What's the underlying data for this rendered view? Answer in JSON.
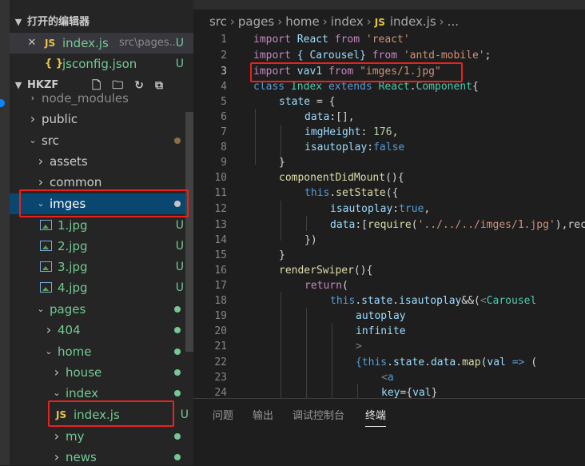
{
  "colors": {
    "accent": "#094771",
    "highlight_box": "#e8221d",
    "git_untracked": "#73c991",
    "git_modified": "#8c6d46"
  },
  "sidebar": {
    "open_editors_title": "打开的编辑器",
    "open_editors": [
      {
        "name": "index.js",
        "path": "src\\pages...",
        "status": "U",
        "icon": "js-icon"
      },
      {
        "name": "jsconfig.json",
        "status": "U",
        "icon": "json-icon"
      }
    ],
    "project_title": "HKZF",
    "toolbar_icons": [
      "new-file-icon",
      "new-folder-icon",
      "refresh-icon",
      "collapse-all-icon"
    ],
    "tree": [
      {
        "label": "node_modules"
      },
      {
        "label": "public"
      },
      {
        "label": "src"
      },
      {
        "label": "assets"
      },
      {
        "label": "common"
      },
      {
        "label": "imges"
      },
      {
        "label": "1.jpg",
        "status": "U"
      },
      {
        "label": "2.jpg",
        "status": "U"
      },
      {
        "label": "3.jpg",
        "status": "U"
      },
      {
        "label": "4.jpg",
        "status": "U"
      },
      {
        "label": "pages"
      },
      {
        "label": "404"
      },
      {
        "label": "home"
      },
      {
        "label": "house"
      },
      {
        "label": "index"
      },
      {
        "label": "index.js",
        "status": "U"
      },
      {
        "label": "my"
      },
      {
        "label": "news"
      }
    ]
  },
  "editor": {
    "breadcrumb": [
      "src",
      "pages",
      "home",
      "index",
      "index.js",
      "..."
    ],
    "line_numbers": [
      "1",
      "2",
      "3",
      "4",
      "5",
      "6",
      "7",
      "8",
      "9",
      "10",
      "11",
      "12",
      "13",
      "14",
      "15",
      "16",
      "17",
      "18",
      "19",
      "20",
      "21",
      "22",
      "23",
      "24"
    ],
    "code": {
      "l1": [
        "import",
        "React",
        "from",
        "'react'"
      ],
      "l2": [
        "import",
        "{ Carousel}",
        "from",
        "'antd-mobile'",
        ";"
      ],
      "l3": [
        "import",
        "vav1",
        "from",
        "\"imges/1.jpg\""
      ],
      "l4": [
        "class",
        "Index",
        "extends",
        "React",
        ".",
        "Component",
        "{"
      ],
      "l5": [
        "state",
        " = {"
      ],
      "l6": [
        "data",
        ":[],"
      ],
      "l7": [
        "imgHeight",
        ": ",
        "176",
        ","
      ],
      "l8": [
        "isautoplay",
        ":",
        "false"
      ],
      "l9": [
        "}"
      ],
      "l10": [
        "componentDidMount",
        "(){"
      ],
      "l11": [
        "this",
        ".",
        "setState",
        "({"
      ],
      "l12": [
        "isautoplay",
        ":",
        "true",
        ","
      ],
      "l13": [
        "data",
        ":[",
        "require",
        "(",
        "'../../../imges/1.jpg'",
        "),rec"
      ],
      "l14": [
        "})"
      ],
      "l15": [
        "}"
      ],
      "l16": [
        "renderSwiper",
        "(){"
      ],
      "l17": [
        "return",
        "("
      ],
      "l18": [
        "this",
        ".",
        "state",
        ".",
        "isautoplay",
        "&&(",
        "<",
        "Carousel"
      ],
      "l19": [
        "autoplay"
      ],
      "l20": [
        "infinite"
      ],
      "l21": [
        ">"
      ],
      "l22": [
        "{",
        "this",
        ".",
        "state",
        ".",
        "data",
        ".",
        "map",
        "(",
        "val",
        " => ",
        "("
      ],
      "l23": [
        "<",
        "a"
      ],
      "l24": [
        "key",
        "={",
        "val",
        "}"
      ]
    }
  },
  "panel": {
    "tabs": [
      "问题",
      "输出",
      "调试控制台",
      "终端"
    ],
    "active_tab": "终端"
  }
}
